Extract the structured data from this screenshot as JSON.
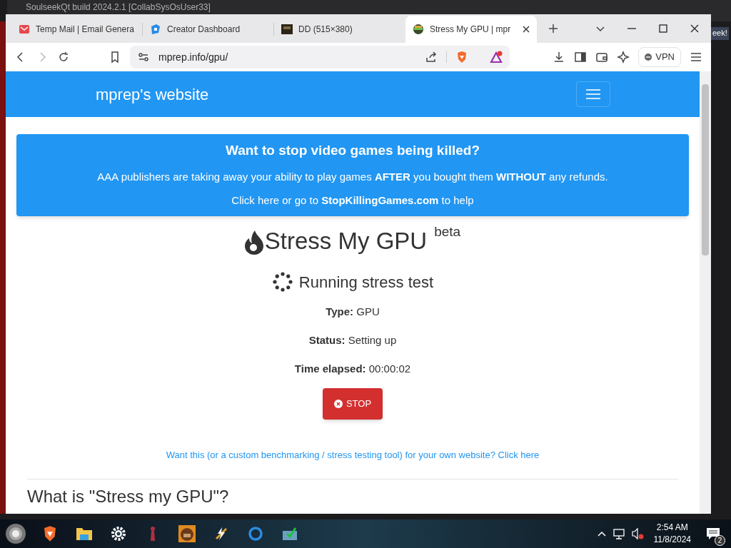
{
  "background_window": {
    "title": "SoulseekQt build 2024.2.1 [CollabSysOsUser33]",
    "edge_text": "eek!"
  },
  "tabs": [
    {
      "title": "Temp Mail | Email Genera",
      "kind": "mail",
      "selected": false
    },
    {
      "title": "Creator Dashboard",
      "kind": "cube",
      "selected": false
    },
    {
      "title": "DD (515×380)",
      "kind": "image",
      "selected": false
    },
    {
      "title": "Stress My GPU | mpr",
      "kind": "face",
      "selected": true
    }
  ],
  "address": "mprep.info/gpu/",
  "vpn": "VPN",
  "page": {
    "site_name": "mprep's website",
    "banner": {
      "heading": "Want to stop video games being killed?",
      "line": "AAA publishers are taking away your ability to play games **AFTER** you bought them **WITHOUT** any refunds.",
      "link_line": "Click here or go to **StopKillingGames.com** to help"
    },
    "title": "Stress My GPU",
    "title_tag": "beta",
    "status_heading": "Running stress test",
    "fields": [
      "**Type:** GPU",
      "**Status:** Setting up",
      "**Time elapsed:** 00:00:02"
    ],
    "stop_button": "STOP",
    "promo_link": "Want this (or a custom benchmarking / stress testing tool) for your own website? Click here",
    "section_heading": "What is \"Stress my GPU\"?"
  },
  "taskbar": {
    "time": "2:54 AM",
    "date": "11/8/2024",
    "notifications": "2"
  }
}
